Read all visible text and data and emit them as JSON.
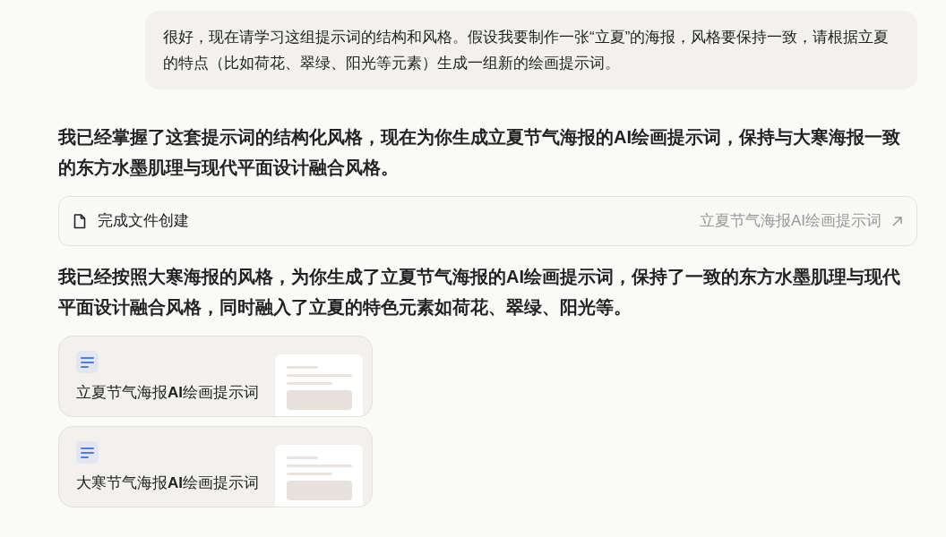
{
  "user_message": "很好，现在请学习这组提示词的结构和风格。假设我要制作一张“立夏”的海报，风格要保持一致，请根据立夏的特点（比如荷花、翠绿、阳光等元素）生成一组新的绘画提示词。",
  "reply_intro": "我已经掌握了这套提示词的结构化风格，现在为你生成立夏节气海报的AI绘画提示词，保持与大寒海报一致的东方水墨肌理与现代平面设计融合风格。",
  "file_status": {
    "label": "完成文件创建",
    "file_name": "立夏节气海报AI绘画提示词"
  },
  "reply_summary": "我已经按照大寒海报的风格，为你生成了立夏节气海报的AI绘画提示词，保持了一致的东方水墨肌理与现代平面设计融合风格，同时融入了立夏的特色元素如荷花、翠绿、阳光等。",
  "documents": [
    {
      "title": "立夏节气海报**AI**绘画提示词"
    },
    {
      "title": "大寒节气海报**AI**绘画提示词"
    }
  ]
}
